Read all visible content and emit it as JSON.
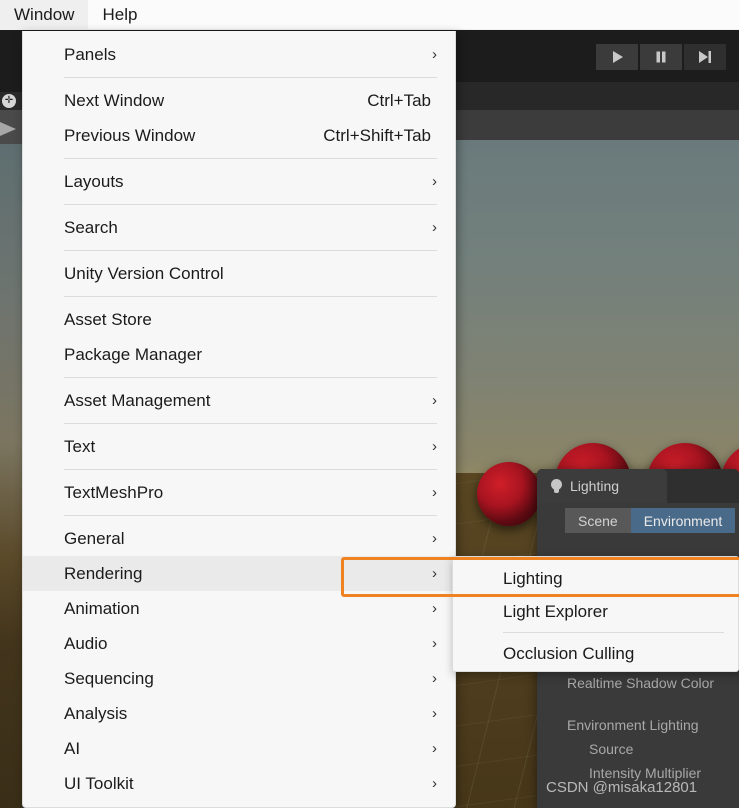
{
  "app": {
    "name": "Unity Editor"
  },
  "menubar": {
    "items": [
      {
        "label": "Window",
        "open": true
      },
      {
        "label": "Help",
        "open": false
      }
    ]
  },
  "window_menu": {
    "groups": [
      {
        "items": [
          {
            "label": "Panels",
            "shortcut": "",
            "submenu": true,
            "highlighted": false
          }
        ]
      },
      {
        "items": [
          {
            "label": "Next Window",
            "shortcut": "Ctrl+Tab",
            "submenu": false,
            "highlighted": false
          },
          {
            "label": "Previous Window",
            "shortcut": "Ctrl+Shift+Tab",
            "submenu": false,
            "highlighted": false
          }
        ]
      },
      {
        "items": [
          {
            "label": "Layouts",
            "shortcut": "",
            "submenu": true,
            "highlighted": false
          }
        ]
      },
      {
        "items": [
          {
            "label": "Search",
            "shortcut": "",
            "submenu": true,
            "highlighted": false
          }
        ]
      },
      {
        "items": [
          {
            "label": "Unity Version Control",
            "shortcut": "",
            "submenu": false,
            "highlighted": false
          }
        ]
      },
      {
        "items": [
          {
            "label": "Asset Store",
            "shortcut": "",
            "submenu": false,
            "highlighted": false
          },
          {
            "label": "Package Manager",
            "shortcut": "",
            "submenu": false,
            "highlighted": false
          }
        ]
      },
      {
        "items": [
          {
            "label": "Asset Management",
            "shortcut": "",
            "submenu": true,
            "highlighted": false
          }
        ]
      },
      {
        "items": [
          {
            "label": "Text",
            "shortcut": "",
            "submenu": true,
            "highlighted": false
          }
        ]
      },
      {
        "items": [
          {
            "label": "TextMeshPro",
            "shortcut": "",
            "submenu": true,
            "highlighted": false
          }
        ]
      },
      {
        "items": [
          {
            "label": "General",
            "shortcut": "",
            "submenu": true,
            "highlighted": false
          },
          {
            "label": "Rendering",
            "shortcut": "",
            "submenu": true,
            "highlighted": true
          },
          {
            "label": "Animation",
            "shortcut": "",
            "submenu": true,
            "highlighted": false
          },
          {
            "label": "Audio",
            "shortcut": "",
            "submenu": true,
            "highlighted": false
          },
          {
            "label": "Sequencing",
            "shortcut": "",
            "submenu": true,
            "highlighted": false
          },
          {
            "label": "Analysis",
            "shortcut": "",
            "submenu": true,
            "highlighted": false
          },
          {
            "label": "AI",
            "shortcut": "",
            "submenu": true,
            "highlighted": false
          },
          {
            "label": "UI Toolkit",
            "shortcut": "",
            "submenu": true,
            "highlighted": false
          }
        ]
      }
    ],
    "submenu_arrow_glyph": "›"
  },
  "rendering_submenu": {
    "groups": [
      {
        "items": [
          {
            "label": "Lighting"
          },
          {
            "label": "Light Explorer"
          }
        ]
      },
      {
        "items": [
          {
            "label": "Occlusion Culling"
          }
        ]
      }
    ]
  },
  "toolbar": {
    "buttons": [
      {
        "name": "play-button",
        "icon": "play-icon"
      },
      {
        "name": "pause-button",
        "icon": "pause-icon"
      },
      {
        "name": "step-button",
        "icon": "step-icon"
      }
    ]
  },
  "lighting_window": {
    "tab_title": "Lighting",
    "tab_icon": "lightbulb-icon",
    "segments": [
      {
        "label": "Scene",
        "active": false
      },
      {
        "label": "Environment",
        "active": true
      }
    ],
    "rows": [
      {
        "label": "Realtime Shadow Color",
        "indent": false
      },
      {
        "label": "Environment Lighting",
        "indent": false
      },
      {
        "label": "Source",
        "indent": true
      },
      {
        "label": "Intensity Multiplier",
        "indent": true
      }
    ]
  },
  "annotation": {
    "type": "highlight-rectangle",
    "color": "#f08321"
  },
  "watermark": {
    "text": "CSDN @misaka12801"
  },
  "colors": {
    "menu_bg": "#f7f7f7",
    "menu_highlight": "#eaeaea",
    "menu_text": "#1b1b1b",
    "editor_bg": "#383838",
    "toolbar_bg": "#1c1c1c",
    "accent_orange": "#f08321",
    "tab_active_blue": "#4a6a89"
  }
}
